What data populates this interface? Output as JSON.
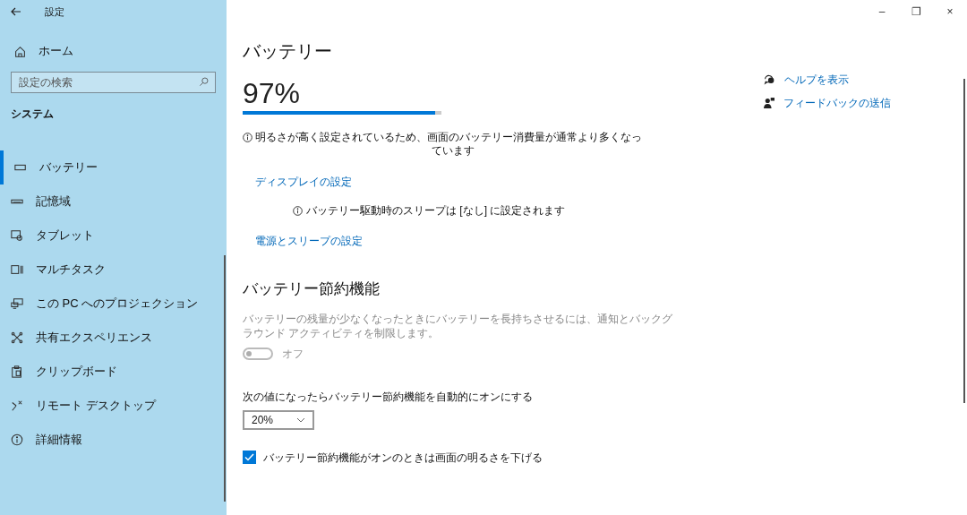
{
  "window": {
    "title": "設定",
    "controls": [
      "–",
      "❐",
      "×"
    ]
  },
  "sidebar": {
    "home": "ホーム",
    "search": {
      "placeholder": "設定の検索"
    },
    "section": "システム",
    "items": [
      {
        "kind": "battery",
        "label": "バッテリー",
        "selected": true
      },
      {
        "kind": "storage",
        "label": "記憶域",
        "selected": false
      },
      {
        "kind": "tablet",
        "label": "タブレット",
        "selected": false
      },
      {
        "kind": "multitask",
        "label": "マルチタスク",
        "selected": false
      },
      {
        "kind": "project",
        "label": "この PC へのプロジェクション",
        "selected": false
      },
      {
        "kind": "shared",
        "label": "共有エクスペリエンス",
        "selected": false
      },
      {
        "kind": "clipboard",
        "label": "クリップボード",
        "selected": false
      },
      {
        "kind": "remote",
        "label": "リモート デスクトップ",
        "selected": false
      },
      {
        "kind": "info",
        "label": "詳細情報",
        "selected": false
      }
    ]
  },
  "page": {
    "title": "バッテリー",
    "percent": "97%",
    "level": 0.97,
    "brightness_note_line1": "明るさが高く設定されているため、画面のバッテリー消費量が通常より多くなっ",
    "brightness_note_line2": "ています",
    "display_link": "ディスプレイの設定",
    "sleep_note": "バッテリー駆動時のスリープは [なし] に設定されます",
    "power_link": "電源とスリープの設定",
    "saver": {
      "heading": "バッテリー節約機能",
      "description": "バッテリーの残量が少なくなったときにバッテリーを長持ちさせるには、通知とバックグラウンド アクティビティを制限します。",
      "toggle": {
        "on": false,
        "disabled": true,
        "label": "オフ"
      },
      "auto_label": "次の値になったらバッテリー節約機能を自動的にオンにする",
      "threshold": "20%",
      "dim": {
        "checked": true,
        "label": "バッテリー節約機能がオンのときは画面の明るさを下げる"
      }
    }
  },
  "help": [
    {
      "kind": "help",
      "label": "ヘルプを表示"
    },
    {
      "kind": "feedback",
      "label": "フィードバックの送信"
    }
  ]
}
